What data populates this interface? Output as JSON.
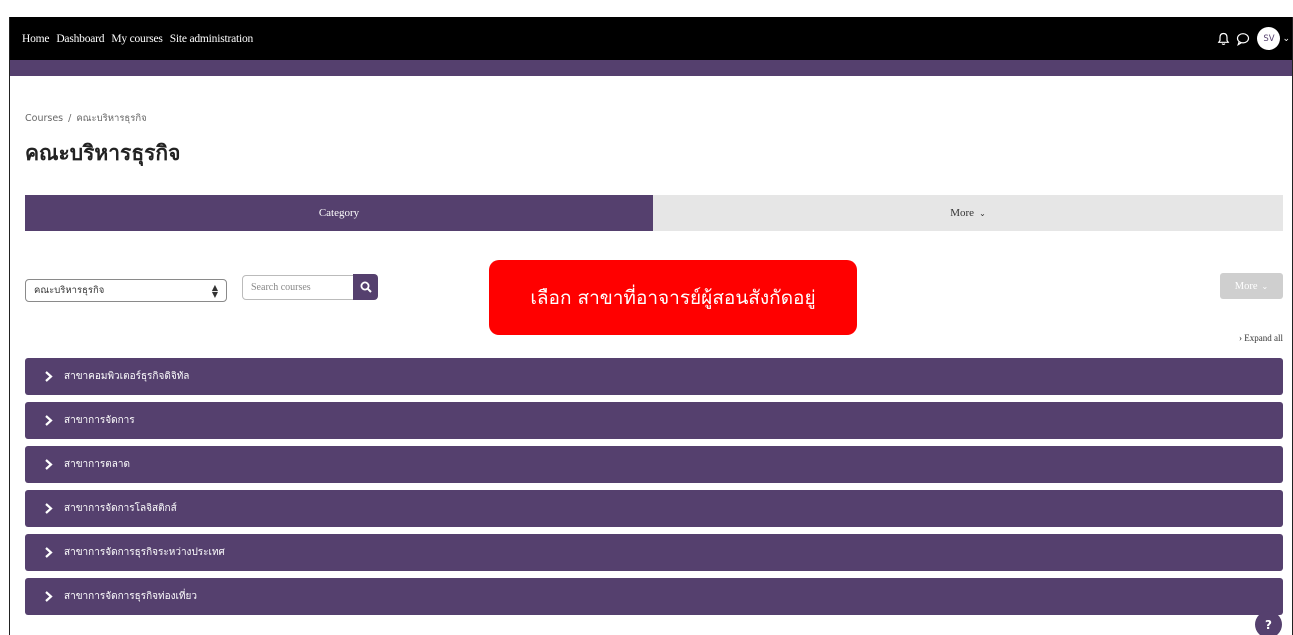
{
  "nav": {
    "links": [
      "Home",
      "Dashboard",
      "My courses",
      "Site administration"
    ],
    "avatar_initials": "SV",
    "icons": [
      "bell-icon",
      "chat-icon"
    ]
  },
  "breadcrumb": {
    "root": "Courses",
    "separator": "/",
    "current": "คณะบริหารธุรกิจ"
  },
  "page_title": "คณะบริหารธุรกิจ",
  "tabs": {
    "category": "Category",
    "more": "More"
  },
  "controls": {
    "category_select_value": "คณะบริหารธุรกิจ",
    "search_placeholder": "Search courses",
    "more_button": "More",
    "expand_all": "Expand all"
  },
  "callout": "เลือก สาขาที่อาจารย์ผู้สอนสังกัดอยู่",
  "categories": [
    "สาขาคอมพิวเตอร์ธุรกิจดิจิทัล",
    "สาขาการจัดการ",
    "สาขาการตลาด",
    "สาขาการจัดการโลจิสติกส์",
    "สาขาการจัดการธุรกิจระหว่างประเทศ",
    "สาขาการจัดการธุรกิจท่องเที่ยว"
  ],
  "help_label": "?",
  "colors": {
    "brand_purple": "#55406e",
    "callout_red": "#ff0000"
  }
}
